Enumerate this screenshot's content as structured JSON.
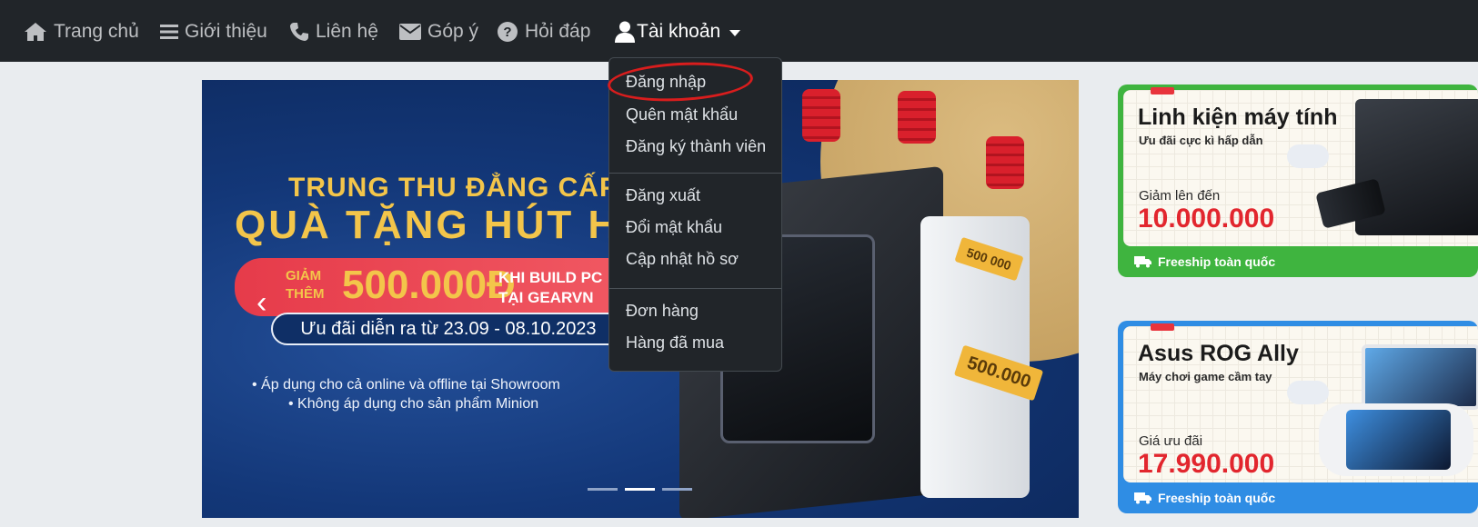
{
  "navbar": {
    "items": [
      {
        "label": "Trang chủ",
        "icon": "home-icon"
      },
      {
        "label": "Giới thiệu",
        "icon": "bars-icon"
      },
      {
        "label": "Liên hệ",
        "icon": "phone-icon"
      },
      {
        "label": "Góp ý",
        "icon": "envelope-icon"
      },
      {
        "label": "Hỏi đáp",
        "icon": "question-circle-icon"
      }
    ],
    "account": {
      "label": "Tài khoản",
      "icon": "user-icon"
    }
  },
  "dropdown": {
    "group1": [
      "Đăng nhập",
      "Quên mật khẩu",
      "Đăng ký thành viên"
    ],
    "group2": [
      "Đăng xuất",
      "Đổi mật khẩu",
      "Cập nhật hồ sơ"
    ],
    "group3": [
      "Đơn hàng",
      "Hàng đã mua"
    ]
  },
  "banner": {
    "title1": "TRUNG THU ĐẲNG CẤP",
    "title2": "QUÀ TẶNG HÚT HỒ",
    "promo_small_1": "GIẢM",
    "promo_small_2": "THÊM",
    "promo_amount": "500.000Đ",
    "promo_right_1": "KHI BUILD PC",
    "promo_right_2": "TẠI GEARVN",
    "date_text": "Ưu đãi diễn ra từ 23.09 - 08.10.2023",
    "bullets": [
      "• Áp dụng cho cả online và offline tại Showroom",
      "• Không áp dụng cho sản phẩm Minion"
    ],
    "tag_1": "500.000",
    "tag_2": "500 000"
  },
  "side1": {
    "title": "Linh kiện máy tính",
    "subtitle": "Ưu đãi cực kì hấp dẫn",
    "price_label": "Giảm lên đến",
    "price": "10.000.000",
    "ship": "Freeship toàn quốc"
  },
  "side2": {
    "title": "Asus ROG Ally",
    "subtitle": "Máy chơi game cầm tay",
    "price_label": "Giá ưu đãi",
    "price": "17.990.000",
    "ship": "Freeship toàn quốc"
  },
  "colors": {
    "navbar": "#212529",
    "highlight_circle": "#d91d1d",
    "price_red": "#e2262e",
    "green": "#3fb43f",
    "blue": "#2f8de4"
  }
}
